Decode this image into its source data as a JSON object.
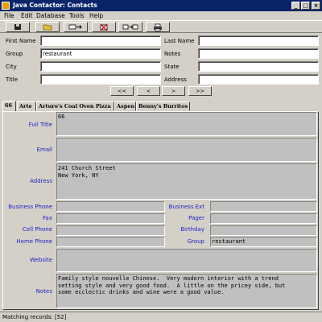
{
  "window": {
    "title": "Java Contactor: Contacts",
    "controls": {
      "minimize": "_",
      "maximize": "□",
      "close": "×"
    }
  },
  "menu": [
    "File",
    "Edit",
    "Database",
    "Tools",
    "Help"
  ],
  "toolbar": {
    "icons": [
      "save-icon",
      "open-folder-icon",
      "add-record-icon",
      "delete-record-icon",
      "merge-records-icon",
      "print-icon"
    ]
  },
  "search": {
    "first_name": {
      "label": "First Name",
      "value": ""
    },
    "group": {
      "label": "Group",
      "value": "restaurant"
    },
    "city": {
      "label": "City",
      "value": ""
    },
    "title": {
      "label": "Title",
      "value": ""
    },
    "last_name": {
      "label": "Last Name",
      "value": ""
    },
    "notes": {
      "label": "Notes",
      "value": ""
    },
    "state": {
      "label": "State",
      "value": ""
    },
    "address": {
      "label": "Address",
      "value": ""
    }
  },
  "nav": {
    "first": "<<",
    "prev": "<",
    "next": ">",
    "last": ">>"
  },
  "tabs": [
    "66",
    "Arte",
    "Arturo's Coal Oven Pizza",
    "Aspen",
    "Benny's Burritos"
  ],
  "detail": {
    "full_title": {
      "label": "Full Title",
      "value": "66"
    },
    "email": {
      "label": "Email",
      "value": ""
    },
    "address": {
      "label": "Address",
      "value": "241 Church Street\nNew York, NY"
    },
    "business_phone": {
      "label": "Business Phone",
      "value": ""
    },
    "fax": {
      "label": "Fax",
      "value": ""
    },
    "cell_phone": {
      "label": "Cell Phone",
      "value": ""
    },
    "home_phone": {
      "label": "Home Phone",
      "value": ""
    },
    "business_ext": {
      "label": "Business Ext",
      "value": ""
    },
    "pager": {
      "label": "Pager",
      "value": ""
    },
    "birthday": {
      "label": "Birthday",
      "value": ""
    },
    "group": {
      "label": "Group",
      "value": "restaurant"
    },
    "website": {
      "label": "Website",
      "value": ""
    },
    "notes": {
      "label": "Notes",
      "value": "Family style nouvelle Chinese.  Very modern interior with a trend\nsetting style and very good food.  A little on the pricey side, but\nsome ecclectic drinks and wine were a good value."
    }
  },
  "status": "Matching records: [52]",
  "colors": {
    "titlebar": "#0a246a",
    "face": "#d4d0c8",
    "detail_label": "#1c1cc8",
    "detail_box": "#c0c0c0"
  }
}
